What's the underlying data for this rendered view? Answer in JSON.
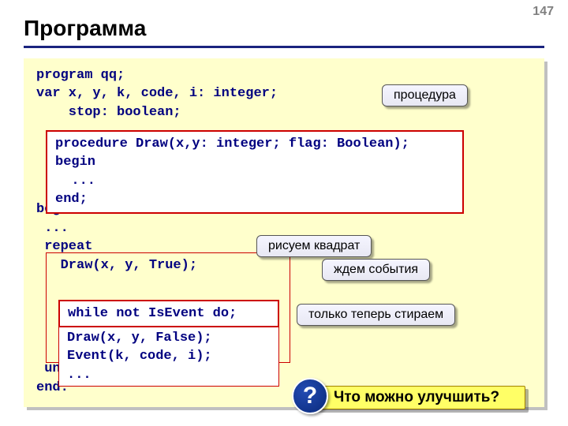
{
  "page_number": "147",
  "title": "Программа",
  "code": {
    "line1": "program qq;",
    "line2": "var x, y, k, code, i: integer;",
    "line3": "    stop: boolean;",
    "procbox": "procedure Draw(x,y: integer; flag: Boolean);\nbegin\n  ...\nend;",
    "begin": "begin",
    "dots1": " ...",
    "repeat": " repeat",
    "drawtrue": "   Draw(x, y, True);",
    "while": "while not IsEvent do;",
    "drawfalse": "Draw(x, y, False);\nEvent(k, code, i);\n...",
    "until": " until stop;",
    "end": "end."
  },
  "callouts": {
    "proc": "процедура",
    "draw": "рисуем квадрат",
    "wait": "ждем события",
    "erase": "только теперь стираем"
  },
  "question_mark": "?",
  "question": "Что можно улучшить?"
}
